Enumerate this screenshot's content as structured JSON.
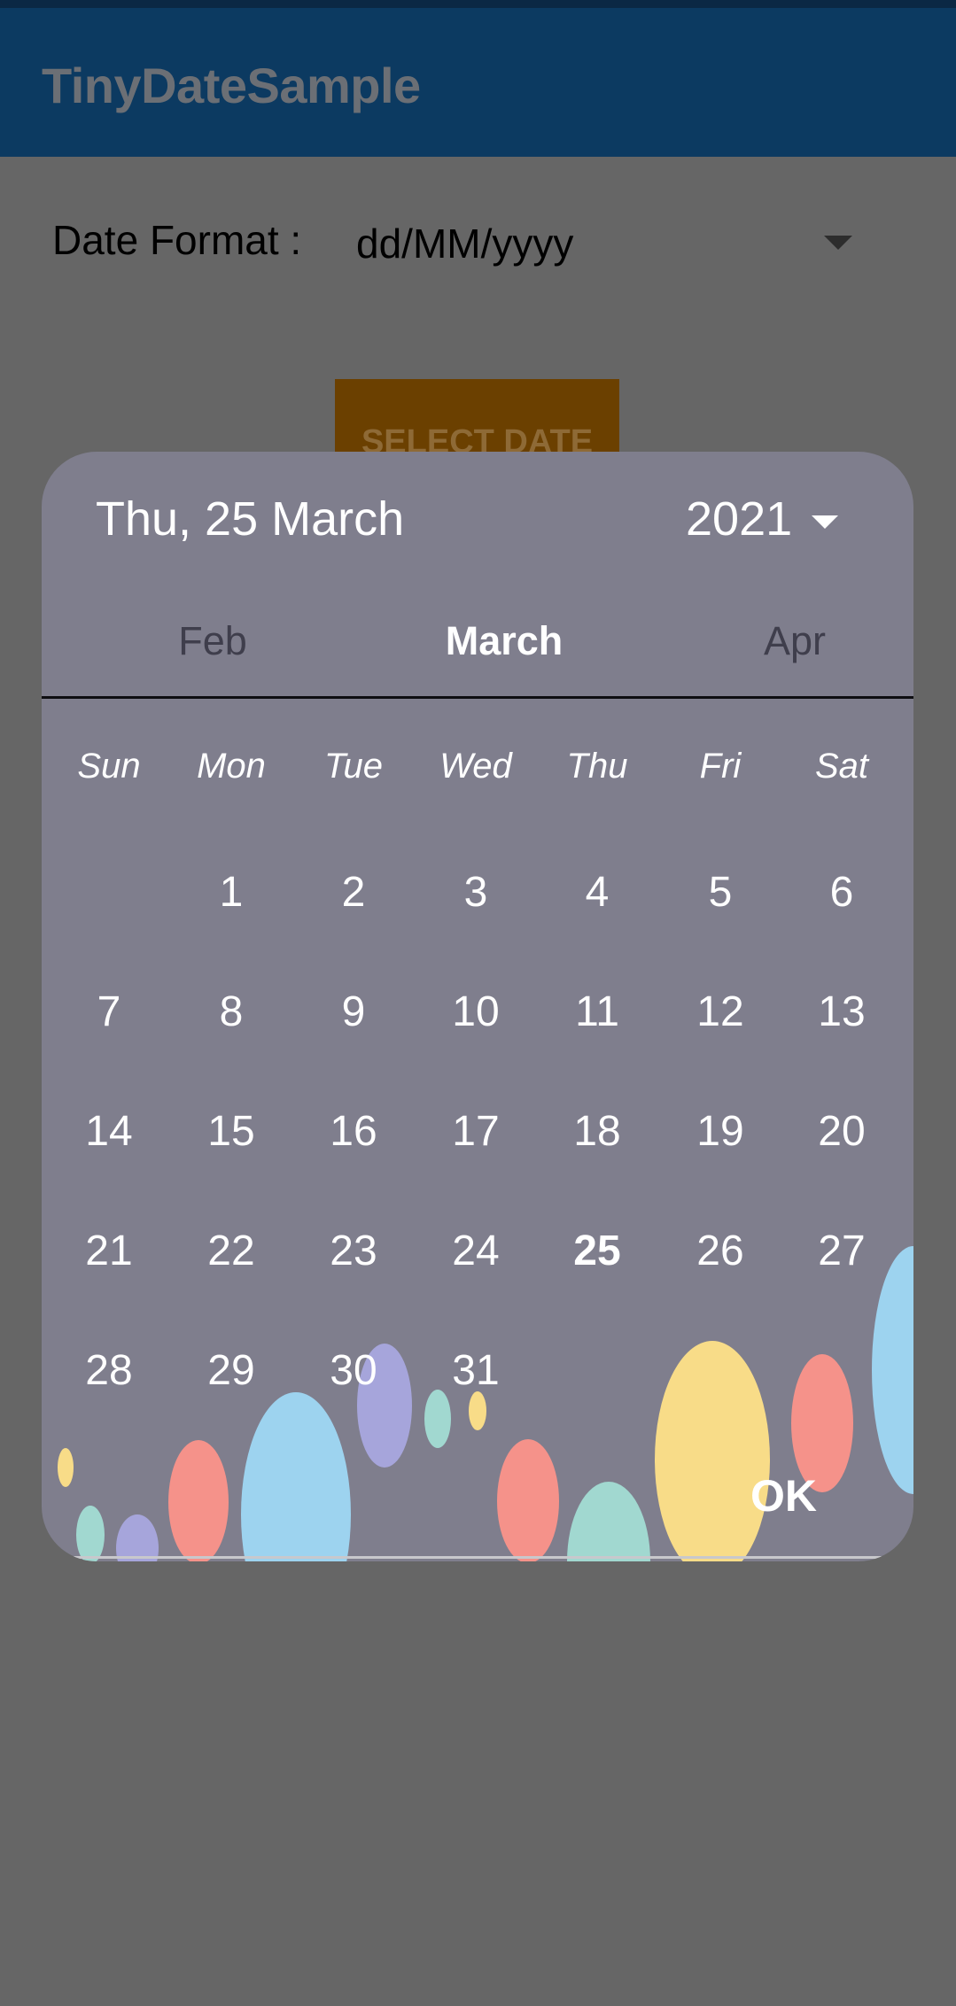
{
  "app": {
    "title": "TinyDateSample"
  },
  "form": {
    "date_format_label": "Date Format :",
    "date_format_value": "dd/MM/yyyy",
    "select_date_label": "SELECT DATE"
  },
  "dialog": {
    "selected_date": "Thu, 25 March",
    "year": "2021",
    "months": {
      "prev": "Feb",
      "current": "March",
      "next": "Apr"
    },
    "weekdays": [
      "Sun",
      "Mon",
      "Tue",
      "Wed",
      "Thu",
      "Fri",
      "Sat"
    ],
    "first_weekday_index": 1,
    "days": [
      "1",
      "2",
      "3",
      "4",
      "5",
      "6",
      "7",
      "8",
      "9",
      "10",
      "11",
      "12",
      "13",
      "14",
      "15",
      "16",
      "17",
      "18",
      "19",
      "20",
      "21",
      "22",
      "23",
      "24",
      "25",
      "26",
      "27",
      "28",
      "29",
      "30",
      "31"
    ],
    "selected_day": "25",
    "ok_label": "OK"
  },
  "colors": {
    "app_bar": "#0c3a61",
    "dialog_bg": "#7f7e8d",
    "scrim": "#666666",
    "select_button": "#6b4000",
    "bubble_blue": "#9dd3ef",
    "bubble_red": "#f5928a",
    "bubble_yellow": "#f8dc88",
    "bubble_purple": "#a6a5db",
    "bubble_teal": "#a1d8d0"
  }
}
